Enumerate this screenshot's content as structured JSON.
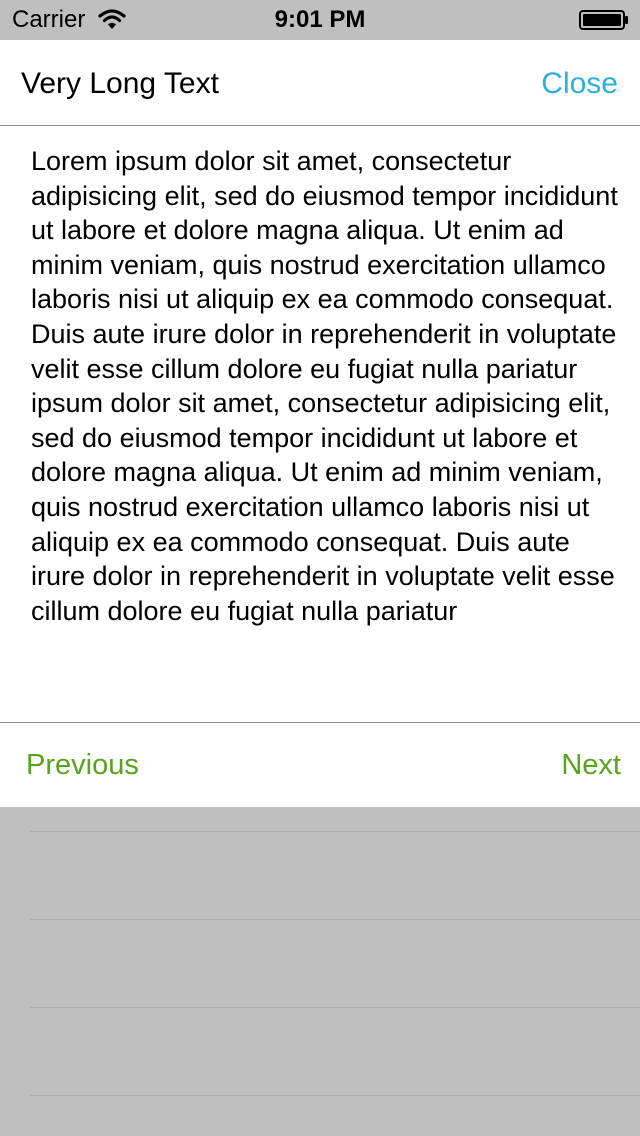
{
  "status_bar": {
    "carrier": "Carrier",
    "time": "9:01 PM",
    "wifi_icon": "wifi-icon",
    "battery_icon": "battery-icon"
  },
  "header": {
    "title": "Very Long Text",
    "close_label": "Close"
  },
  "content": {
    "text": "Lorem ipsum dolor sit amet, consectetur adipisicing elit, sed do eiusmod tempor incididunt ut labore et dolore magna aliqua. Ut enim ad minim veniam, quis nostrud exercitation ullamco laboris nisi ut aliquip ex ea commodo consequat. Duis aute irure dolor in reprehenderit in voluptate velit esse cillum dolore eu fugiat nulla pariatur ipsum dolor sit amet, consectetur adipisicing elit, sed do eiusmod tempor incididunt ut labore et dolore magna aliqua. Ut enim ad minim veniam, quis nostrud exercitation ullamco laboris nisi ut aliquip ex ea commodo consequat. Duis aute irure dolor in reprehenderit in voluptate velit esse cillum dolore eu fugiat nulla pariatur"
  },
  "footer": {
    "previous_label": "Previous",
    "next_label": "Next"
  },
  "colors": {
    "accent_blue": "#2bb0d9",
    "accent_green": "#5aa31c",
    "overlay_gray": "#bfbfbf"
  }
}
